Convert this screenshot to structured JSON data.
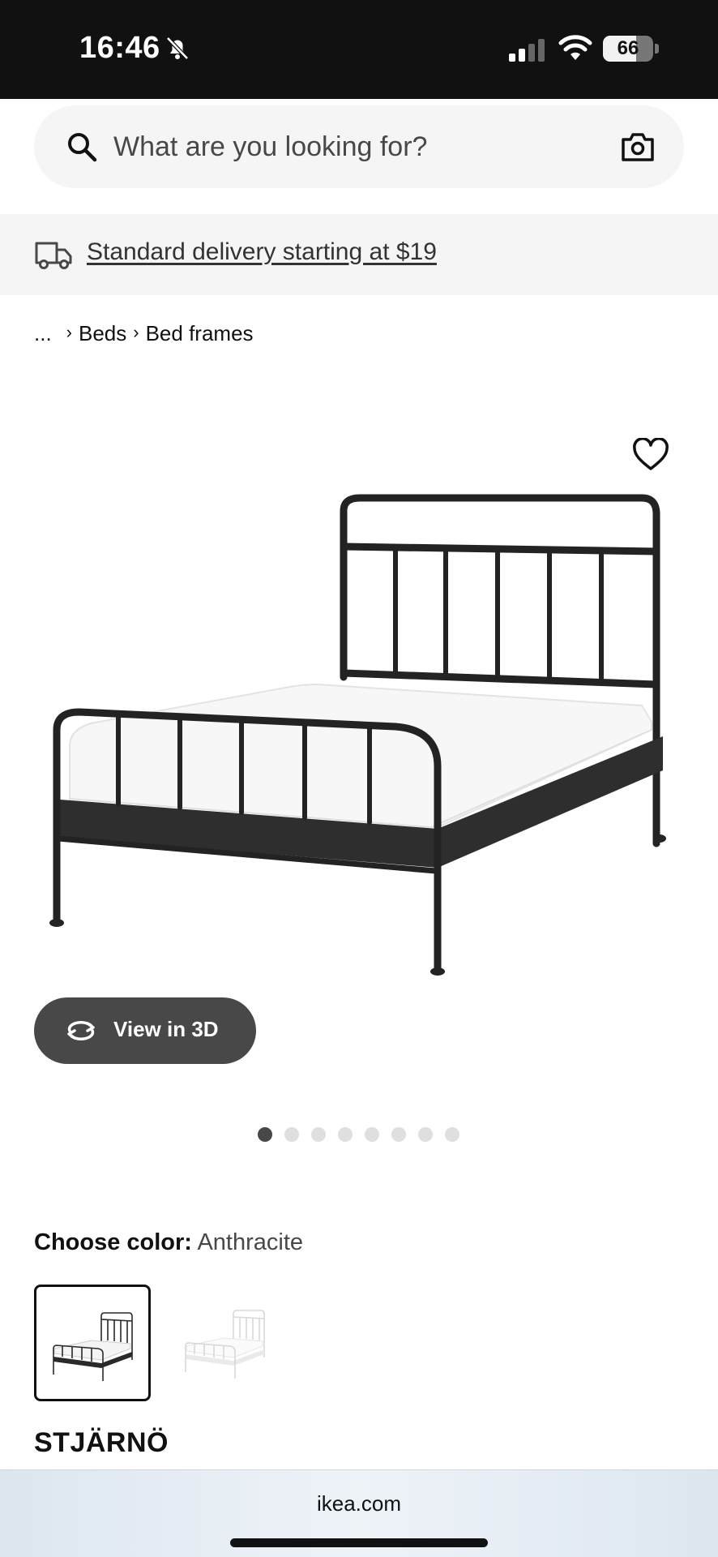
{
  "status_bar": {
    "time": "16:46",
    "battery": "66",
    "battery_level": 0.66
  },
  "search": {
    "placeholder": "What are you looking for?"
  },
  "delivery": {
    "text": "Standard delivery starting at $19"
  },
  "breadcrumb": {
    "ellipsis": "...",
    "items": [
      "Beds",
      "Bed frames"
    ]
  },
  "product": {
    "view_3d_label": "View in 3D",
    "carousel": {
      "total": 8,
      "active": 1
    },
    "color_label": "Choose color:",
    "color_value": "Anthracite",
    "swatches": [
      {
        "name": "Anthracite",
        "color": "#222222",
        "selected": true
      },
      {
        "name": "White",
        "color": "#e8e8e8",
        "selected": false
      }
    ],
    "name": "STJÄRNÖ"
  },
  "browser": {
    "url": "ikea.com"
  }
}
